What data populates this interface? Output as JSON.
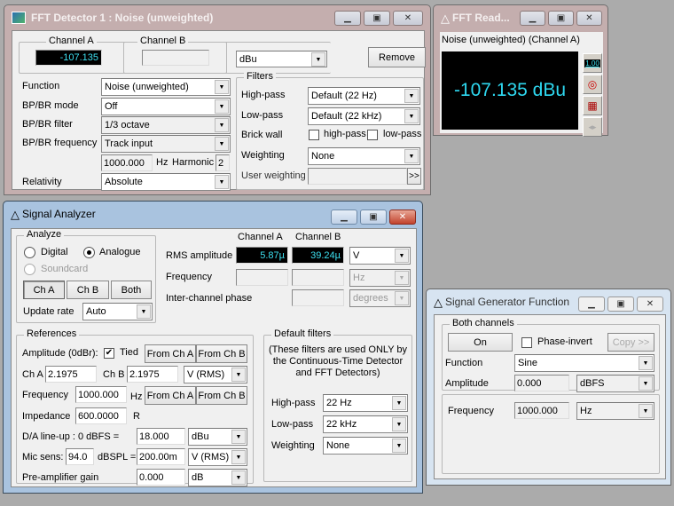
{
  "fft_detector": {
    "title": "FFT Detector 1 : Noise (unweighted)",
    "channel_a_label": "Channel A",
    "channel_a_value": "-107.135",
    "channel_b_label": "Channel B",
    "channel_b_value": "",
    "unit": "dBu",
    "remove_label": "Remove",
    "function_label": "Function",
    "function_value": "Noise (unweighted)",
    "bpbr_mode_label": "BP/BR mode",
    "bpbr_mode_value": "Off",
    "bpbr_filter_label": "BP/BR filter",
    "bpbr_filter_value": "1/3 octave",
    "bpbr_freq_label": "BP/BR frequency",
    "bpbr_freq_value": "Track input",
    "freq_value": "1000.000",
    "hz_label": "Hz",
    "harmonic_label": "Harmonic",
    "harmonic_value": "2",
    "relativity_label": "Relativity",
    "relativity_value": "Absolute",
    "filters": {
      "label": "Filters",
      "highpass_label": "High-pass",
      "highpass_value": "Default (22 Hz)",
      "lowpass_label": "Low-pass",
      "lowpass_value": "Default (22 kHz)",
      "brickwall_label": "Brick wall",
      "brick_highpass_label": "high-pass",
      "brick_lowpass_label": "low-pass",
      "weighting_label": "Weighting",
      "weighting_value": "None",
      "user_weighting_label": "User weighting",
      "user_weighting_value": "",
      "browse_label": ">>"
    }
  },
  "fft_reading": {
    "title": "FFT Read...",
    "subtitle": "Noise (unweighted) (Channel A)",
    "value": "-107.135 dBu",
    "side_icons": [
      "numeric-display-icon",
      "meter-icon",
      "spreadsheet-icon",
      "arrows-icon"
    ],
    "numeric_icon_text": "1.00"
  },
  "signal_analyzer": {
    "title": "Signal Analyzer",
    "analyze": {
      "label": "Analyze",
      "digital": "Digital",
      "analogue": "Analogue",
      "soundcard": "Soundcard",
      "ch_a": "Ch A",
      "ch_b": "Ch B",
      "both": "Both",
      "update_rate_label": "Update rate",
      "update_rate_value": "Auto"
    },
    "readings": {
      "channel_a_header": "Channel A",
      "channel_b_header": "Channel B",
      "rms_label": "RMS amplitude",
      "rms_a": "5.87µ",
      "rms_b": "39.24µ",
      "rms_unit": "V",
      "freq_label": "Frequency",
      "freq_a": "",
      "freq_b": "",
      "freq_unit": "Hz",
      "phase_label": "Inter-channel phase",
      "phase_value": "",
      "phase_unit": "degrees"
    },
    "references": {
      "label": "References",
      "amplitude_label": "Amplitude (0dBr):",
      "tied_label": "Tied",
      "from_ch_a": "From Ch A",
      "from_ch_b": "From Ch B",
      "ch_a_label": "Ch A",
      "ch_a_value": "2.1975",
      "ch_b_label": "Ch B",
      "ch_b_value": "2.1975",
      "amp_unit": "V (RMS)",
      "frequency_label": "Frequency",
      "frequency_value": "1000.000",
      "hz_label": "Hz",
      "impedance_label": "Impedance",
      "impedance_value": "600.0000",
      "ohm_label": "R",
      "da_label": "D/A line-up : 0 dBFS =",
      "da_value": "18.000",
      "da_unit": "dBu",
      "mic_label": "Mic sens:",
      "mic_spl": "94.0",
      "dbspl_label": "dBSPL =",
      "mic_value": "200.00m",
      "mic_unit": "V (RMS)",
      "preamp_label": "Pre-amplifier gain",
      "preamp_value": "0.000",
      "preamp_unit": "dB"
    },
    "default_filters": {
      "label": "Default filters",
      "note": "(These filters are used ONLY by the Continuous-Time Detector and FFT Detectors)",
      "highpass_label": "High-pass",
      "highpass_value": "22 Hz",
      "lowpass_label": "Low-pass",
      "lowpass_value": "22 kHz",
      "weighting_label": "Weighting",
      "weighting_value": "None"
    }
  },
  "signal_generator": {
    "title": "Signal Generator Function",
    "both_channels_label": "Both channels",
    "on_label": "On",
    "phase_invert_label": "Phase-invert",
    "copy_label": "Copy >>",
    "function_label": "Function",
    "function_value": "Sine",
    "amplitude_label": "Amplitude",
    "amplitude_value": "0.000",
    "amplitude_unit": "dBFS",
    "frequency_label": "Frequency",
    "frequency_value": "1000.000",
    "frequency_unit": "Hz"
  }
}
